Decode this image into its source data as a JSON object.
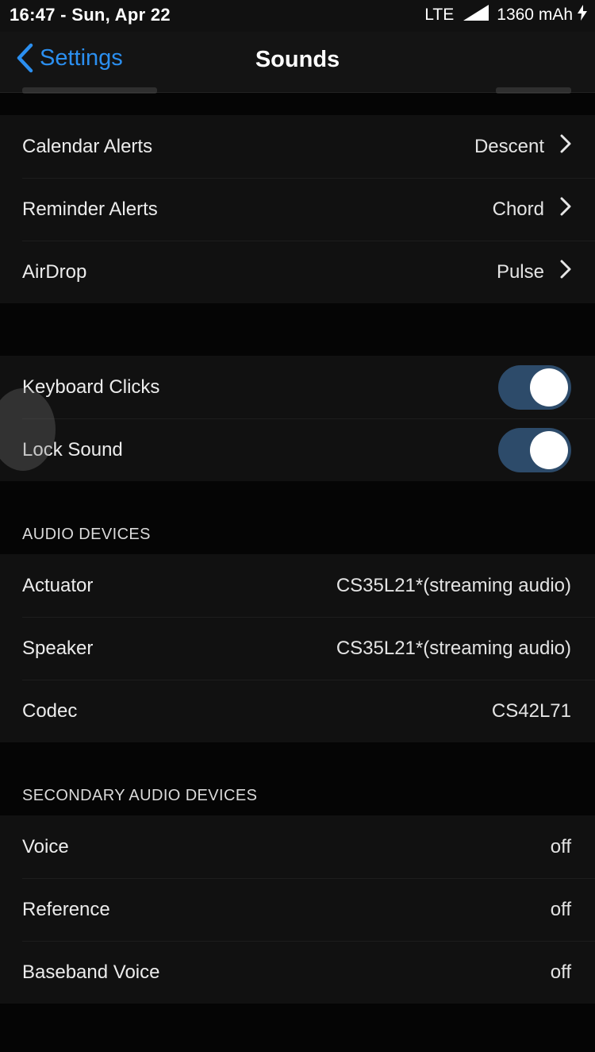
{
  "status_bar": {
    "time_date": "16:47 - Sun, Apr 22",
    "network": "LTE",
    "battery": "1360 mAh"
  },
  "nav": {
    "back_label": "Settings",
    "title": "Sounds"
  },
  "alerts_group": [
    {
      "label": "Calendar Alerts",
      "value": "Descent"
    },
    {
      "label": "Reminder Alerts",
      "value": "Chord"
    },
    {
      "label": "AirDrop",
      "value": "Pulse"
    }
  ],
  "toggles_group": [
    {
      "label": "Keyboard Clicks",
      "on": true
    },
    {
      "label": "Lock Sound",
      "on": true
    }
  ],
  "audio_devices": {
    "header": "AUDIO DEVICES",
    "rows": [
      {
        "label": "Actuator",
        "value": "CS35L21*(streaming audio)"
      },
      {
        "label": "Speaker",
        "value": "CS35L21*(streaming audio)"
      },
      {
        "label": "Codec",
        "value": "CS42L71"
      }
    ]
  },
  "secondary_audio_devices": {
    "header": "SECONDARY AUDIO DEVICES",
    "rows": [
      {
        "label": "Voice",
        "value": "off"
      },
      {
        "label": "Reference",
        "value": "off"
      },
      {
        "label": "Baseband Voice",
        "value": "off"
      }
    ]
  },
  "colors": {
    "accent": "#2b8ff0",
    "toggle_on": "#2d4b6a",
    "background": "#050505",
    "cell": "#111111"
  },
  "icons": {
    "back": "chevron-left-icon",
    "disclosure": "chevron-right-icon",
    "signal": "cellular-signal-icon",
    "charging": "charging-bolt-icon"
  }
}
